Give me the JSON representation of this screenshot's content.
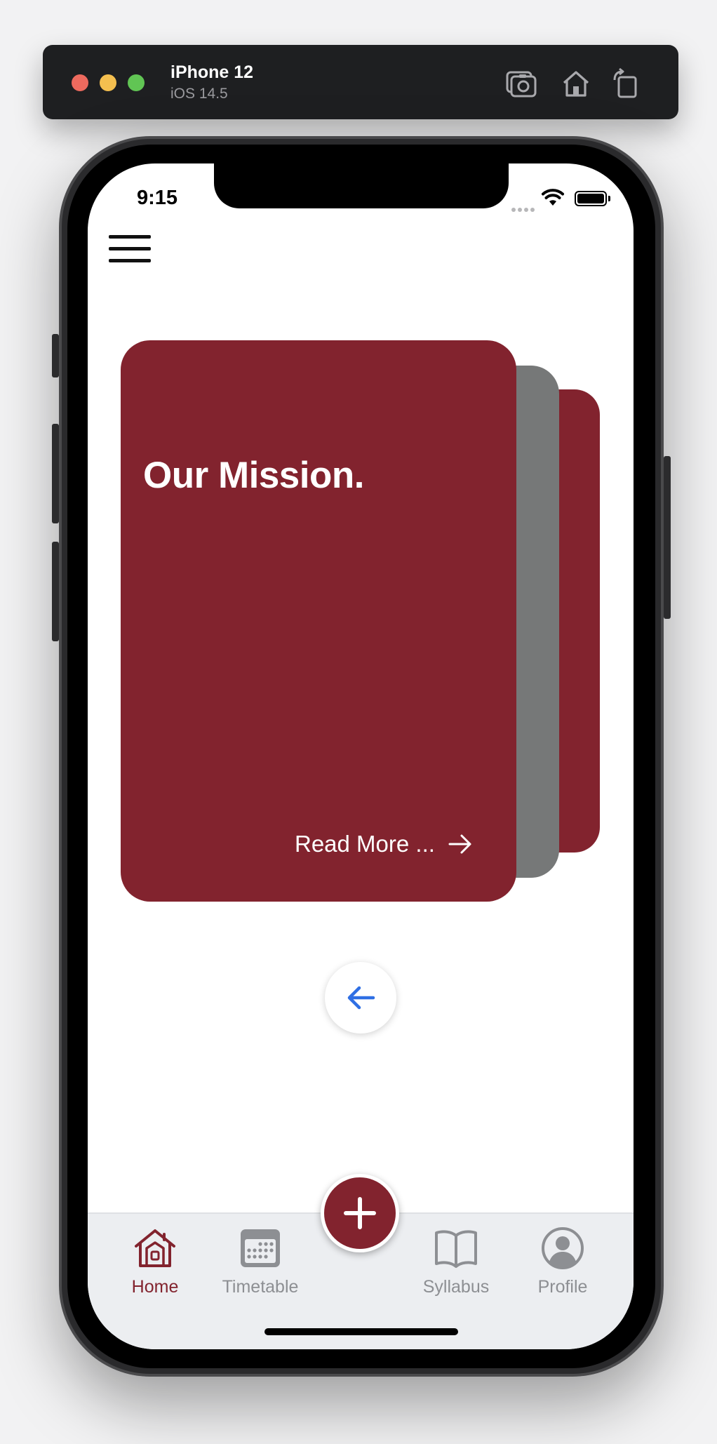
{
  "simulator": {
    "device_name": "iPhone 12",
    "os_version": "iOS 14.5",
    "toolbar_icons": [
      "screenshot-icon",
      "home-icon",
      "rotate-icon"
    ]
  },
  "status_bar": {
    "time": "9:15"
  },
  "carousel": {
    "cards": [
      {
        "title": "Our Mission.",
        "link_label": "Read More ..."
      }
    ],
    "card_colors": [
      "#82232E",
      "#767878",
      "#82232E"
    ]
  },
  "tab_bar": {
    "items": [
      {
        "label": "Home",
        "icon": "home-icon",
        "active": true
      },
      {
        "label": "Timetable",
        "icon": "calendar-icon",
        "active": false
      },
      {
        "label": "Syllabus",
        "icon": "book-icon",
        "active": false
      },
      {
        "label": "Profile",
        "icon": "user-circle-icon",
        "active": false
      }
    ],
    "fab_icon": "plus-icon"
  },
  "colors": {
    "brand": "#82232E",
    "accent_blue": "#2F6FE4",
    "inactive_gray": "#8D8F93"
  }
}
